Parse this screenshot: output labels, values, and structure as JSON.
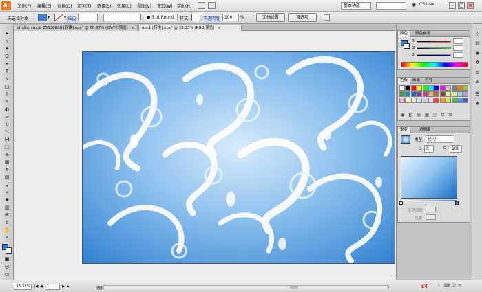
{
  "app": {
    "logo": "Ai",
    "workspace": "基本功能",
    "cs_live": "CS Live"
  },
  "menu": [
    "文件(F)",
    "编辑(E)",
    "对象(O)",
    "文字(T)",
    "选择(S)",
    "效果(C)",
    "视图(V)",
    "窗口(W)",
    "帮助(H)"
  ],
  "control": {
    "selection_status": "未选择对象",
    "stroke_label": "描边:",
    "brush": "3 pt Round",
    "style_label": "样式:",
    "opacity_label": "不透明度",
    "opacity_value": "100",
    "opacity_unit": "%",
    "doc_setup": "文档设置",
    "preferences": "首选项"
  },
  "doc_tabs": [
    {
      "label": "shutterstock_25538868 [转换].eps* @ 66.67% (CMYK/预览)",
      "close": "×"
    },
    {
      "label": "abc1 [转换].eps* @ 33.33% (RGB/预览)",
      "close": "×"
    }
  ],
  "color_panel": {
    "tabs": [
      "颜色",
      "颜色参考"
    ],
    "channels": [
      "R",
      "G",
      "B"
    ]
  },
  "swatch_panel": {
    "tabs": [
      "色板",
      "画笔",
      "符号"
    ]
  },
  "gradient_panel": {
    "tabs": [
      "渐变",
      "透明度"
    ],
    "type_label": "类型:",
    "type_value": "径向",
    "angle_value": "0",
    "ratio_value": "100",
    "opacity_label": "不透明度",
    "position_label": "位置"
  },
  "status": {
    "zoom": "33.33%",
    "page": "1",
    "tool": "选择"
  },
  "taskbar": {
    "ime": "S中"
  }
}
